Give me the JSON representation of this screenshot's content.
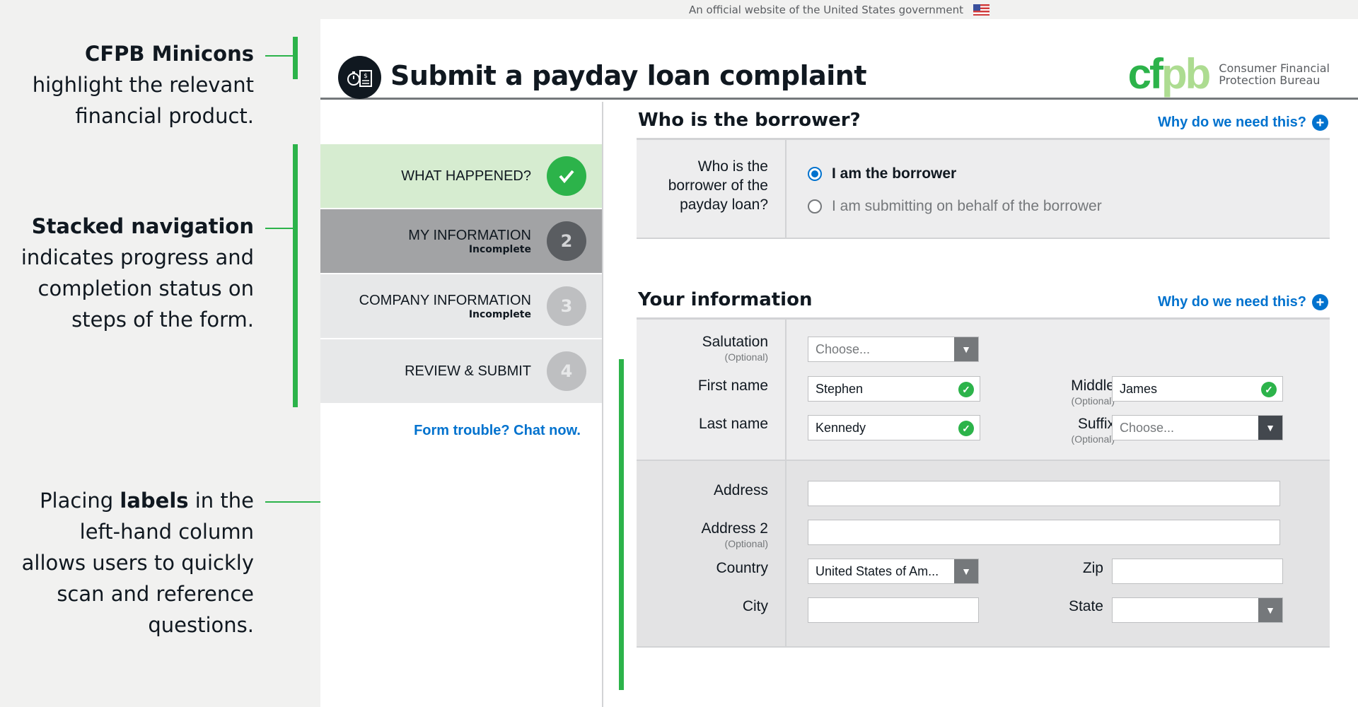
{
  "annotations": [
    {
      "bold": "CFPB Minicons",
      "text_after": " highlight the relevant financial product."
    },
    {
      "bold": "Stacked navigation",
      "text_after": " indicates progress and completion status on steps of the form."
    },
    {
      "before": "Placing ",
      "bold": "labels",
      "text_after": " in the left-hand column allows users to quickly scan and reference questions."
    }
  ],
  "gov_banner": {
    "text": "An official website of the United States government",
    "flag_icon": "us-flag-icon"
  },
  "header": {
    "title": "Submit a payday loan complaint",
    "minicon": "payday-loan-icon",
    "logo_mark": {
      "part1": "cf",
      "part2": "pb"
    },
    "logo_sub_line1": "Consumer Financial",
    "logo_sub_line2": "Protection Bureau"
  },
  "steps": [
    {
      "label": "WHAT HAPPENED?",
      "status": "",
      "number": "✓",
      "state": "done"
    },
    {
      "label": "MY INFORMATION",
      "status": "Incomplete",
      "number": "2",
      "state": "current"
    },
    {
      "label": "COMPANY INFORMATION",
      "status": "Incomplete",
      "number": "3",
      "state": "todo"
    },
    {
      "label": "REVIEW & SUBMIT",
      "status": "",
      "number": "4",
      "state": "todo"
    }
  ],
  "chat_link": "Form trouble? Chat now.",
  "borrower_section": {
    "title": "Who is the borrower?",
    "why": "Why do we need this?",
    "question": "Who is the borrower of the payday loan?",
    "options": [
      "I am the borrower",
      "I am submitting on behalf of the borrower"
    ],
    "selected": 0
  },
  "info_section": {
    "title": "Your information",
    "why": "Why do we need this?",
    "optional": "(Optional)",
    "salutation": {
      "label": "Salutation",
      "placeholder": "Choose..."
    },
    "first_name": {
      "label": "First name",
      "value": "Stephen"
    },
    "middle": {
      "label": "Middle",
      "value": "James"
    },
    "last_name": {
      "label": "Last name",
      "value": "Kennedy"
    },
    "suffix": {
      "label": "Suffix",
      "placeholder": "Choose..."
    },
    "address": {
      "label": "Address",
      "value": ""
    },
    "address2": {
      "label": "Address 2",
      "value": ""
    },
    "country": {
      "label": "Country",
      "value": "United States of Am..."
    },
    "zip": {
      "label": "Zip",
      "value": ""
    },
    "city": {
      "label": "City",
      "value": ""
    },
    "state": {
      "label": "State",
      "value": ""
    }
  },
  "colors": {
    "brand_green": "#2cb34a",
    "link_blue": "#0072ce",
    "annotation_green": "#2cb34a"
  }
}
